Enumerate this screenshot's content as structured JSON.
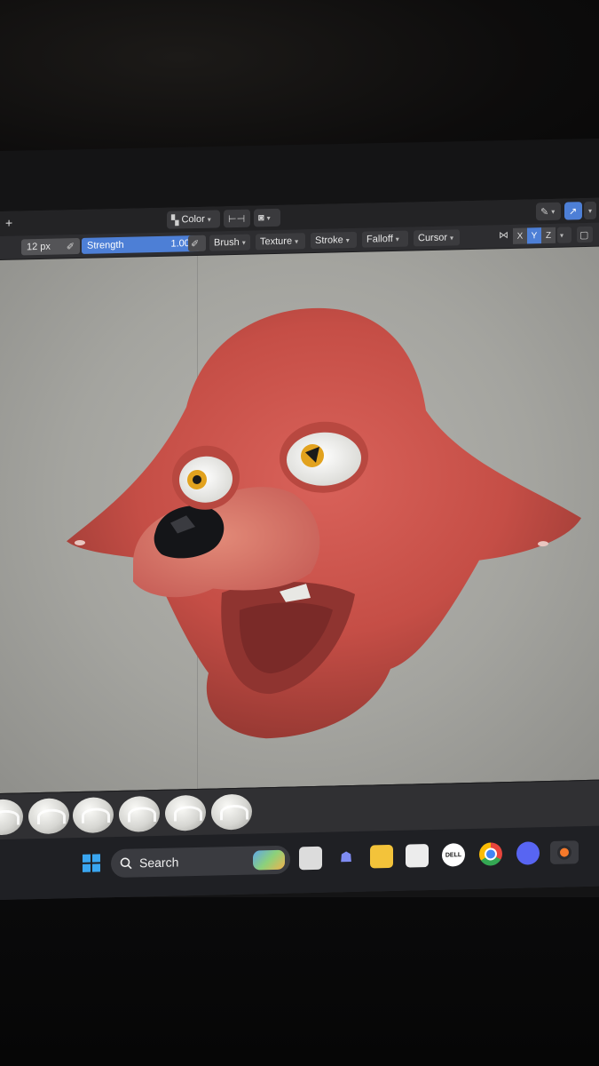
{
  "header": {
    "add_tab": "+",
    "color_label": "Color"
  },
  "toolbar": {
    "radius_value": "12 px",
    "strength_label": "Strength",
    "strength_value": "1.000",
    "menus": [
      "Brush",
      "Texture",
      "Stroke",
      "Falloff",
      "Cursor"
    ],
    "axis_x": "X",
    "axis_y": "Y",
    "axis_z": "Z"
  },
  "taskbar": {
    "search_label": "Search",
    "dell_label": "DELL"
  },
  "icons": [
    "windows-start-icon",
    "search-icon",
    "task-view-icon",
    "teams-icon",
    "file-explorer-icon",
    "store-icon",
    "dell-icon",
    "chrome-icon",
    "discord-icon",
    "blender-icon"
  ],
  "colors": {
    "model_red": "#c9524a",
    "strength_blue": "#4d7fd6",
    "viewport_grey": "#a8a8a3"
  }
}
